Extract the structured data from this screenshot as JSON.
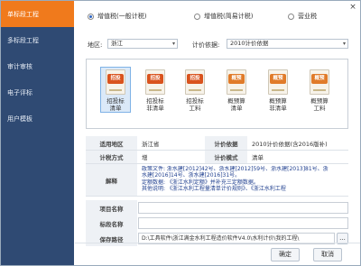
{
  "window": {
    "close_glyph": "×"
  },
  "sidebar": {
    "items": [
      {
        "label": "单标段工程",
        "active": true
      },
      {
        "label": "多标段工程",
        "active": false
      },
      {
        "label": "审计审核",
        "active": false
      },
      {
        "label": "电子评标",
        "active": false
      },
      {
        "label": "用户模板",
        "active": false
      }
    ]
  },
  "tax_options": [
    {
      "label": "增值税(一般计税)",
      "checked": true
    },
    {
      "label": "增值税(简易计税)",
      "checked": false
    },
    {
      "label": "营业税",
      "checked": false
    }
  ],
  "region": {
    "label": "地区:",
    "value": "浙江"
  },
  "basis": {
    "label": "计价依据:",
    "value": "2010计价依据"
  },
  "templates": [
    {
      "badge": "招投",
      "name": "招投标\n清单",
      "badge_color": "#d9531e",
      "selected": true
    },
    {
      "badge": "招投",
      "name": "招投标\n非清单",
      "badge_color": "#d9531e",
      "selected": false
    },
    {
      "badge": "招投",
      "name": "招投标\n工料",
      "badge_color": "#d9531e",
      "selected": false
    },
    {
      "badge": "概预",
      "name": "概预算\n清单",
      "badge_color": "#e07b2a",
      "selected": false
    },
    {
      "badge": "概预",
      "name": "概预算\n非清单",
      "badge_color": "#e07b2a",
      "selected": false
    },
    {
      "badge": "概预",
      "name": "概预算\n工料",
      "badge_color": "#e07b2a",
      "selected": false
    }
  ],
  "info": {
    "region_label": "适用地区",
    "region_value": "浙江省",
    "basis_label": "计价依据",
    "basis_value": "2010计价依据(含2016版补)",
    "method_label": "计税方式",
    "method_value": "增",
    "mode_label": "计价模式",
    "mode_value": "清单",
    "explain_label": "解释",
    "explain_lines": [
      "政策文件: 浙水建[2012]42号、浙水建[2012]59号、浙水建[2013]81号、浙",
      "水建[2016]14号、浙水建[2016]31号。",
      "定额数据: 《浙江水利定额》并补充三定额数据。",
      "其他说明: 《浙江水利工程量清单计价规则》、《浙江水利工程"
    ]
  },
  "project_name": {
    "label": "项目名称",
    "value": ""
  },
  "section_name": {
    "label": "标段名称",
    "value": ""
  },
  "save_path": {
    "label": "保存路径",
    "value": "D:\\工具软件\\浙江满金水利工程造价软件V4.0\\水利计价\\我的工程\\",
    "browse": "..."
  },
  "buttons": {
    "ok": "确定",
    "cancel": "取消"
  },
  "colors": {
    "sidebar_bg": "#2f4a73",
    "sidebar_active": "#f07a1c"
  }
}
